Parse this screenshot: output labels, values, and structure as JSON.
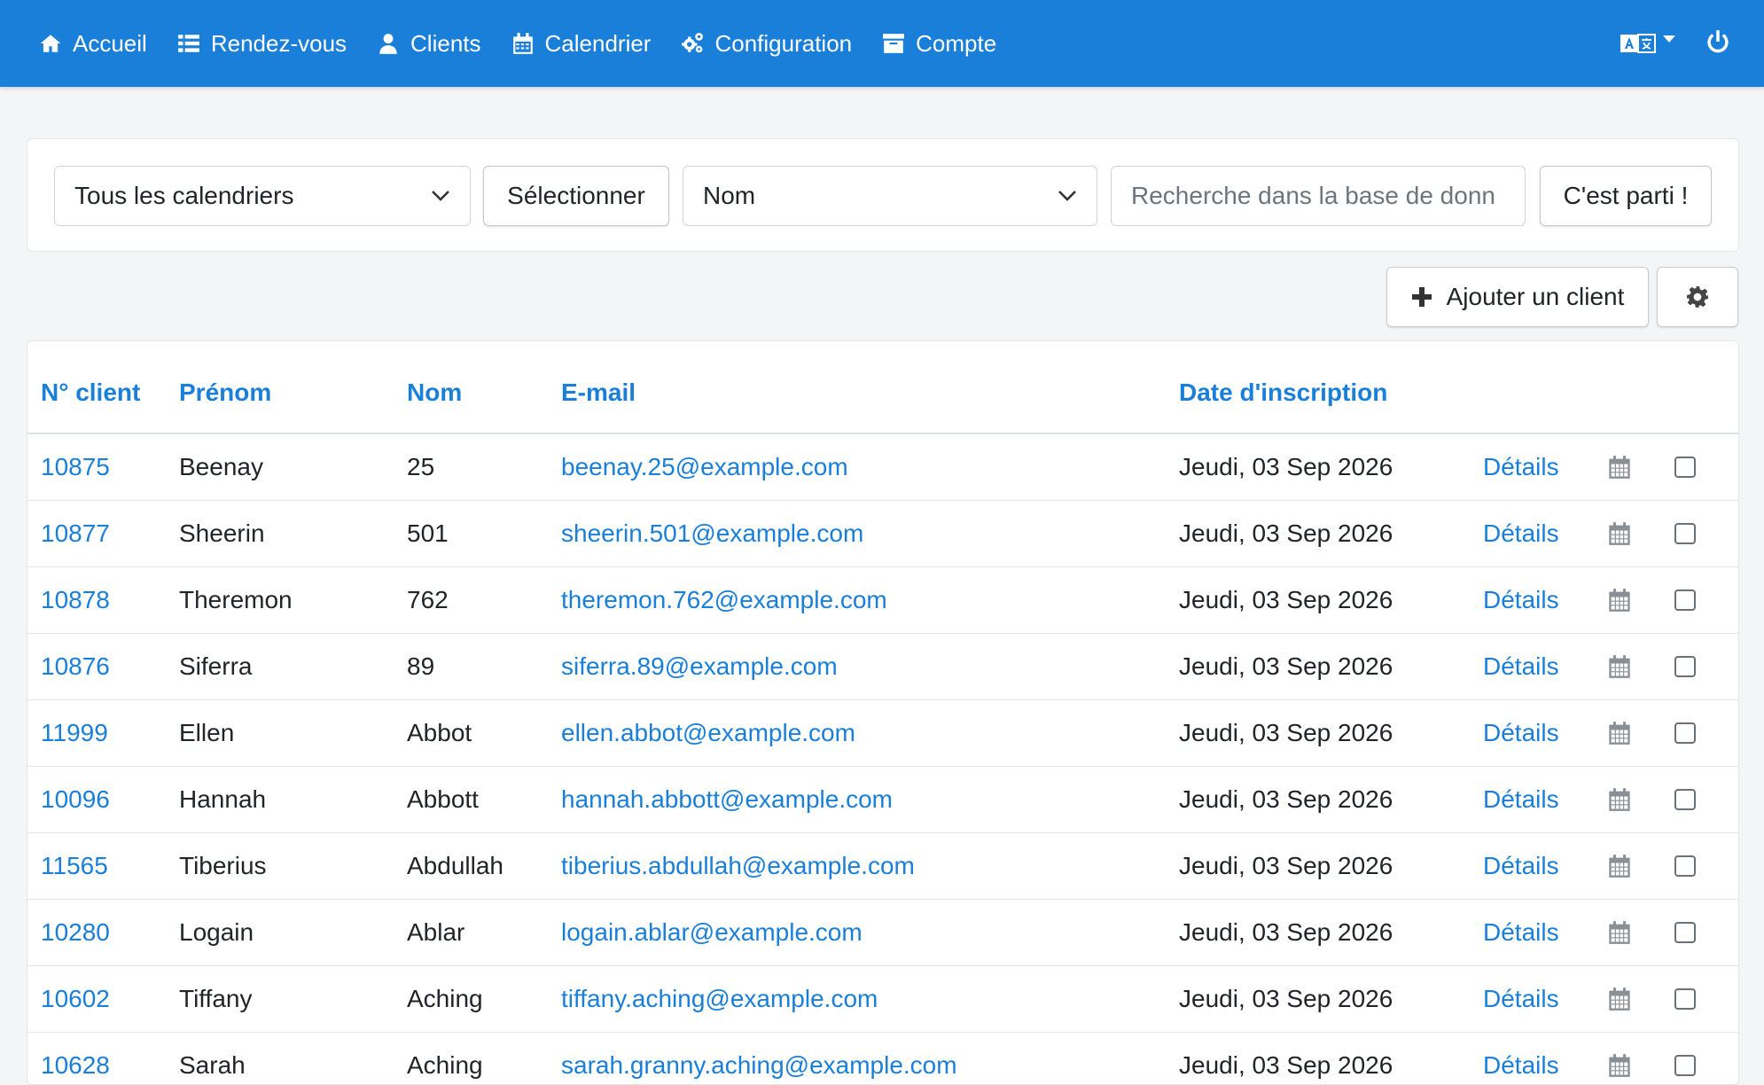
{
  "nav": {
    "items": [
      {
        "label": "Accueil",
        "icon": "home-icon"
      },
      {
        "label": "Rendez-vous",
        "icon": "list-icon"
      },
      {
        "label": "Clients",
        "icon": "user-icon"
      },
      {
        "label": "Calendrier",
        "icon": "calendar-icon"
      },
      {
        "label": "Configuration",
        "icon": "cogs-icon"
      },
      {
        "label": "Compte",
        "icon": "archive-icon"
      }
    ],
    "language_icon": "translate-icon",
    "power_icon": "power-icon"
  },
  "filters": {
    "calendar_select": "Tous les calendriers",
    "select_button": "Sélectionner",
    "field_select": "Nom",
    "search_placeholder": "Recherche dans la base de donn",
    "go_button": "C'est parti !"
  },
  "actions": {
    "add_client": "Ajouter un client",
    "settings_icon": "gear-icon"
  },
  "table": {
    "headers": {
      "client_no": "N° client",
      "first_name": "Prénom",
      "last_name": "Nom",
      "email": "E-mail",
      "registration_date": "Date d'inscription"
    },
    "details_label": "Détails",
    "rows": [
      {
        "id": "10875",
        "first": "Beenay",
        "last": "25",
        "email": "beenay.25@example.com",
        "date": "Jeudi, 03 Sep 2026"
      },
      {
        "id": "10877",
        "first": "Sheerin",
        "last": "501",
        "email": "sheerin.501@example.com",
        "date": "Jeudi, 03 Sep 2026"
      },
      {
        "id": "10878",
        "first": "Theremon",
        "last": "762",
        "email": "theremon.762@example.com",
        "date": "Jeudi, 03 Sep 2026"
      },
      {
        "id": "10876",
        "first": "Siferra",
        "last": "89",
        "email": "siferra.89@example.com",
        "date": "Jeudi, 03 Sep 2026"
      },
      {
        "id": "11999",
        "first": "Ellen",
        "last": "Abbot",
        "email": "ellen.abbot@example.com",
        "date": "Jeudi, 03 Sep 2026"
      },
      {
        "id": "10096",
        "first": "Hannah",
        "last": "Abbott",
        "email": "hannah.abbott@example.com",
        "date": "Jeudi, 03 Sep 2026"
      },
      {
        "id": "11565",
        "first": "Tiberius",
        "last": "Abdullah",
        "email": "tiberius.abdullah@example.com",
        "date": "Jeudi, 03 Sep 2026"
      },
      {
        "id": "10280",
        "first": "Logain",
        "last": "Ablar",
        "email": "logain.ablar@example.com",
        "date": "Jeudi, 03 Sep 2026"
      },
      {
        "id": "10602",
        "first": "Tiffany",
        "last": "Aching",
        "email": "tiffany.aching@example.com",
        "date": "Jeudi, 03 Sep 2026"
      },
      {
        "id": "10628",
        "first": "Sarah",
        "last": "Aching",
        "email": "sarah.granny.aching@example.com",
        "date": "Jeudi, 03 Sep 2026"
      }
    ]
  },
  "colors": {
    "primary": "#1a7fd9",
    "text": "#212529"
  }
}
